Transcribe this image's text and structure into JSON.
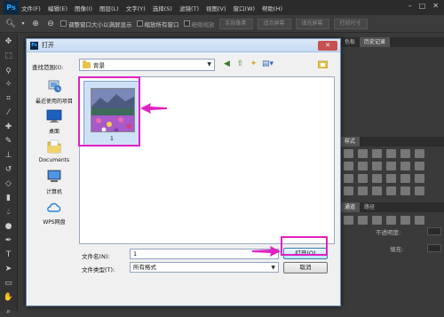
{
  "app": {
    "logo": "Ps",
    "menus": [
      "文件(F)",
      "编辑(E)",
      "图像(I)",
      "图层(L)",
      "文字(Y)",
      "选择(S)",
      "滤镜(T)",
      "视图(V)",
      "窗口(W)",
      "帮助(H)"
    ]
  },
  "options_bar": {
    "resize_windows": "调整窗口大小以满屏显示",
    "zoom_all": "缩放所有窗口",
    "scrubby_zoom": "细微缩放",
    "actual_pixels": "实际像素",
    "fit_screen": "适合屏幕",
    "fill_screen": "填充屏幕",
    "print_size": "打印尺寸"
  },
  "right_panel": {
    "tab_color": "色板",
    "tab_history": "历史记录",
    "tab_styles": "样式",
    "tab_channels": "通道",
    "tab_paths": "路径",
    "opacity_label": "不透明度:",
    "fill_label": "填充:"
  },
  "dialog": {
    "title": "打开",
    "look_in_label": "查找范围(I):",
    "look_in_value": "背景",
    "places": [
      {
        "label": "最近使用的项目",
        "icon": "recent-items-icon"
      },
      {
        "label": "桌面",
        "icon": "desktop-icon"
      },
      {
        "label": "Documents",
        "icon": "documents-folder-icon"
      },
      {
        "label": "计算机",
        "icon": "computer-icon"
      },
      {
        "label": "WPS网盘",
        "icon": "cloud-drive-icon"
      }
    ],
    "files": [
      {
        "name": "1",
        "icon": "image-thumbnail"
      }
    ],
    "file_name_label": "文件名(N):",
    "file_name_value": "1",
    "file_type_label": "文件类型(T):",
    "file_type_value": "所有格式",
    "open_button": "打开(O)",
    "cancel_button": "取消"
  },
  "colors": {
    "annotation": "#e020c0",
    "dialog_bg": "#f0f0f0",
    "selection": "#cfe1f7"
  }
}
